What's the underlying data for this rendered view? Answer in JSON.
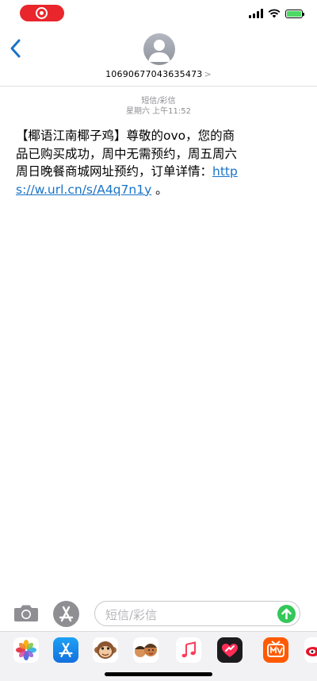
{
  "status_bar": {
    "recording_color": "#e8262c",
    "battery_color": "#4cd964"
  },
  "header": {
    "contact": "10690677043635473",
    "contact_chevron": ">"
  },
  "thread": {
    "service": "短信/彩信",
    "timestamp": "星期六 上午11:52",
    "message_text": "【椰语江南椰子鸡】尊敬的ovo，您的商品已购买成功，周中无需预约，周五周六周日晚餐商城网址预约，订单详情：",
    "message_link": "https://w.url.cn/s/A4q7n1y",
    "message_tail": " 。"
  },
  "input_bar": {
    "placeholder": "短信/彩信",
    "send_color": "#34c759"
  },
  "apps": [
    {
      "name": "photos-icon"
    },
    {
      "name": "app-store-icon"
    },
    {
      "name": "animoji-icon"
    },
    {
      "name": "memoji-icon"
    },
    {
      "name": "music-icon"
    },
    {
      "name": "digital-touch-icon"
    },
    {
      "name": "mango-tv-icon"
    },
    {
      "name": "weibo-icon"
    }
  ]
}
